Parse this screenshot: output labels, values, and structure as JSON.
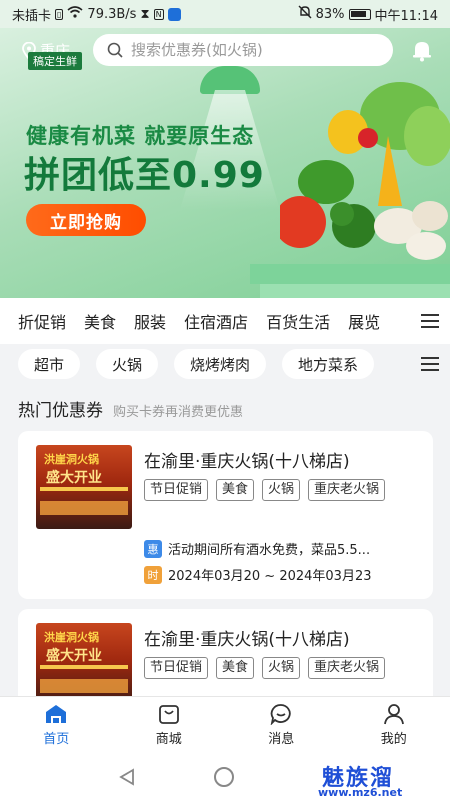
{
  "status_bar": {
    "carrier": "未插卡",
    "speed": "79.3B/s",
    "battery": "83%",
    "time": "中午11:14"
  },
  "header": {
    "location": "重庆",
    "brand_tag": "稿定生鲜",
    "search_placeholder": "搜索优惠券(如火锅)"
  },
  "banner": {
    "line1": "健康有机菜 就要原生态",
    "line2": "拼团低至0.99",
    "cta": "立即抢购",
    "active_slide": 2,
    "total_slides": 2
  },
  "categories": [
    "折促销",
    "美食",
    "服装",
    "住宿酒店",
    "百货生活",
    "展览"
  ],
  "chips": [
    "超市",
    "火锅",
    "烧烤烤肉",
    "地方菜系"
  ],
  "section": {
    "title": "热门优惠券",
    "subtitle": "购买卡券再消费更优惠"
  },
  "coupons": [
    {
      "name": "在渝里·重庆火锅(十八梯店)",
      "thumb_line1": "洪崖洞火锅",
      "thumb_line2": "盛大开业",
      "tags": [
        "节日促销",
        "美食",
        "火锅",
        "重庆老火锅"
      ],
      "promo_icon": "惠",
      "promo": "活动期间所有酒水免费，菜品5.5...",
      "time_icon": "时",
      "period": "2024年03月20 ~ 2024年03月23"
    },
    {
      "name": "在渝里·重庆火锅(十八梯店)",
      "thumb_line1": "洪崖洞火锅",
      "thumb_line2": "盛大开业",
      "tags": [
        "节日促销",
        "美食",
        "火锅",
        "重庆老火锅"
      ]
    }
  ],
  "tabs": [
    {
      "label": "首页",
      "icon": "home-icon",
      "active": true
    },
    {
      "label": "商城",
      "icon": "shop-bag-icon",
      "active": false
    },
    {
      "label": "消息",
      "icon": "chat-icon",
      "active": false
    },
    {
      "label": "我的",
      "icon": "user-icon",
      "active": false
    }
  ],
  "watermark": {
    "text": "魅族溜",
    "url": "www.mz6.net"
  },
  "colors": {
    "accent_blue": "#1e6fd9",
    "cta_orange": "#ff5a0a",
    "banner_green": "#137a3b",
    "promo_icon": "#3d8ae8",
    "time_icon": "#f0a13a"
  }
}
